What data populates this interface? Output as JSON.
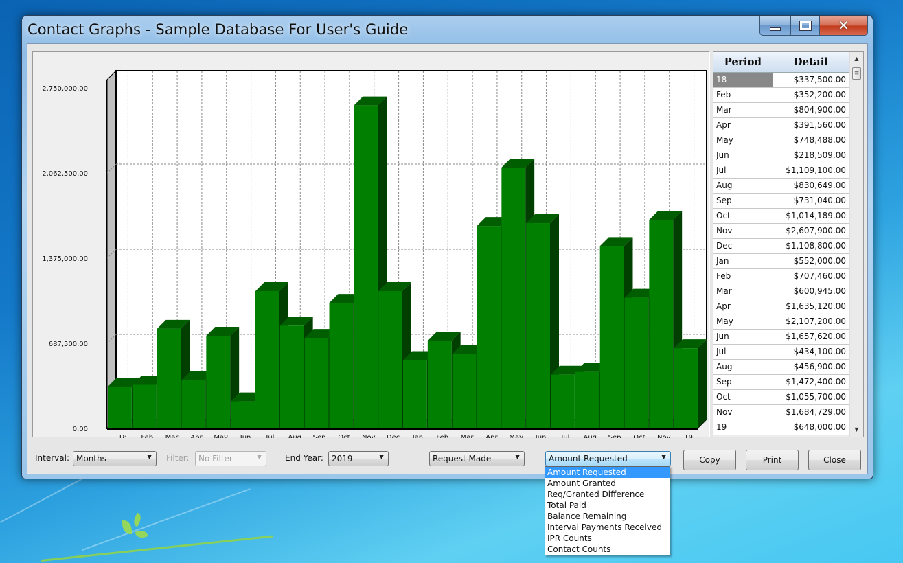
{
  "window": {
    "title": "Contact Graphs - Sample Database For User's Guide",
    "controls": {
      "minimize": "minimize-icon",
      "maximize": "maximize-icon",
      "close": "close-icon"
    }
  },
  "grid": {
    "headers": {
      "period": "Period",
      "detail": "Detail"
    },
    "rows": [
      {
        "period": "18",
        "detail": "$337,500.00"
      },
      {
        "period": "Feb",
        "detail": "$352,200.00"
      },
      {
        "period": "Mar",
        "detail": "$804,900.00"
      },
      {
        "period": "Apr",
        "detail": "$391,560.00"
      },
      {
        "period": "May",
        "detail": "$748,488.00"
      },
      {
        "period": "Jun",
        "detail": "$218,509.00"
      },
      {
        "period": "Jul",
        "detail": "$1,109,100.00"
      },
      {
        "period": "Aug",
        "detail": "$830,649.00"
      },
      {
        "period": "Sep",
        "detail": "$731,040.00"
      },
      {
        "period": "Oct",
        "detail": "$1,014,189.00"
      },
      {
        "period": "Nov",
        "detail": "$2,607,900.00"
      },
      {
        "period": "Dec",
        "detail": "$1,108,800.00"
      },
      {
        "period": "Jan",
        "detail": "$552,000.00"
      },
      {
        "period": "Feb",
        "detail": "$707,460.00"
      },
      {
        "period": "Mar",
        "detail": "$600,945.00"
      },
      {
        "period": "Apr",
        "detail": "$1,635,120.00"
      },
      {
        "period": "May",
        "detail": "$2,107,200.00"
      },
      {
        "period": "Jun",
        "detail": "$1,657,620.00"
      },
      {
        "period": "Jul",
        "detail": "$434,100.00"
      },
      {
        "period": "Aug",
        "detail": "$456,900.00"
      },
      {
        "period": "Sep",
        "detail": "$1,472,400.00"
      },
      {
        "period": "Oct",
        "detail": "$1,055,700.00"
      },
      {
        "period": "Nov",
        "detail": "$1,684,729.00"
      },
      {
        "period": "19",
        "detail": "$648,000.00"
      }
    ],
    "selected_index": 0
  },
  "controls": {
    "interval_label": "Interval:",
    "interval_value": "Months",
    "filter_label": "Filter:",
    "filter_value": "No Filter",
    "end_year_label": "End Year:",
    "end_year_value": "2019",
    "date_basis_value": "Request Made",
    "measure_value": "Amount Requested",
    "copy_label": "Copy",
    "print_label": "Print",
    "close_label": "Close"
  },
  "measure_dropdown": {
    "options": [
      "Amount Requested",
      "Amount Granted",
      "Req/Granted Difference",
      "Total Paid",
      "Balance Remaining",
      "Interval Payments Received",
      "IPR Counts",
      "Contact Counts"
    ],
    "selected_index": 0
  },
  "colors": {
    "bar_front": "#007f00",
    "bar_top": "#005e00",
    "bar_side": "#003f00",
    "selection": "#3399ff"
  },
  "chart_data": {
    "type": "bar",
    "style": "3d",
    "title": "",
    "xlabel": "",
    "ylabel": "",
    "categories": [
      "18",
      "Feb",
      "Mar",
      "Apr",
      "May",
      "Jun",
      "Jul",
      "Aug",
      "Sep",
      "Oct",
      "Nov",
      "Dec",
      "Jan",
      "Feb",
      "Mar",
      "Apr",
      "May",
      "Jun",
      "Jul",
      "Aug",
      "Sep",
      "Oct",
      "Nov",
      "19"
    ],
    "values": [
      337500,
      352200,
      804900,
      391560,
      748488,
      218509,
      1109100,
      830649,
      731040,
      1014189,
      2607900,
      1108800,
      552000,
      707460,
      600945,
      1635120,
      2107200,
      1657620,
      434100,
      456900,
      1472400,
      1055700,
      1684729,
      648000
    ],
    "ylim": [
      0,
      2750000
    ],
    "yticks": [
      0,
      687500,
      1375000,
      2062500,
      2750000
    ],
    "ytick_labels": [
      "0.00",
      "687,500.00",
      "1,375,000.00",
      "2,062,500.00",
      "2,750,000.00"
    ],
    "grid": true
  }
}
